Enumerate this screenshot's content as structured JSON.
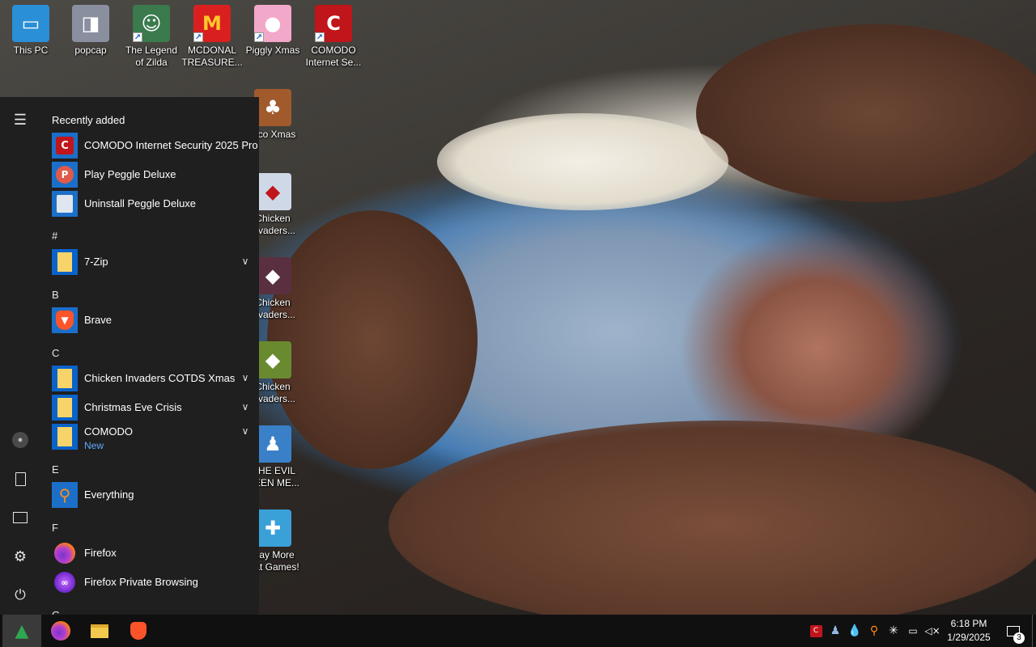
{
  "desktop": {
    "icons": [
      {
        "label": "This PC",
        "icon": "computer-icon",
        "color": "#2a8fd6"
      },
      {
        "label": "popcap",
        "icon": "folder-icon",
        "color": "#8a8fa0"
      },
      {
        "label": "The Legend of Zilda",
        "icon": "zilda-game-icon",
        "color": "#3a7a4c"
      },
      {
        "label": "MCDONAL TREASURE...",
        "icon": "mcdonalds-icon",
        "color": "#da1f1f"
      },
      {
        "label": "Piggly Xmas",
        "icon": "pig-icon",
        "color": "#f2a8c8"
      },
      {
        "label": "COMODO Internet Se...",
        "icon": "comodo-icon",
        "color": "#c0151a"
      },
      {
        "label": "...co Xmas",
        "icon": "bear-icon",
        "color": "#a05a2c"
      },
      {
        "label": "Chicken ...vaders...",
        "icon": "chicken-icon",
        "color": "#cfd8e6"
      },
      {
        "label": "Chicken ...vaders...",
        "icon": "chicken-icon",
        "color": "#5a3040"
      },
      {
        "label": "Chicken ...vaders...",
        "icon": "chicken-icon",
        "color": "#6a8a30"
      },
      {
        "label": "...HE EVIL ...EEN ME...",
        "icon": "people-icon",
        "color": "#3a80c8"
      },
      {
        "label": "...ay More ...at Games!",
        "icon": "games-icon",
        "color": "#3aa0d8"
      }
    ]
  },
  "start_menu": {
    "section_title": "Recently added",
    "recent": [
      {
        "name": "COMODO Internet Security 2025 Pro",
        "icon": "comodo-icon",
        "color": "#c0151a"
      },
      {
        "name": "Play Peggle Deluxe",
        "icon": "peggle-icon",
        "color": "#3b78c4"
      },
      {
        "name": "Uninstall Peggle Deluxe",
        "icon": "uninstall-icon",
        "color": "#3b78c4"
      }
    ],
    "groups": [
      {
        "letter": "#",
        "apps": [
          {
            "name": "7-Zip",
            "icon": "folder-icon",
            "expandable": true
          }
        ]
      },
      {
        "letter": "B",
        "apps": [
          {
            "name": "Brave",
            "icon": "brave-icon"
          }
        ]
      },
      {
        "letter": "C",
        "apps": [
          {
            "name": "Chicken Invaders COTDS Xmas",
            "icon": "folder-icon",
            "expandable": true
          },
          {
            "name": "Christmas Eve Crisis",
            "icon": "folder-icon",
            "expandable": true
          },
          {
            "name": "COMODO",
            "subtitle": "New",
            "icon": "folder-icon",
            "expandable": true
          }
        ]
      },
      {
        "letter": "E",
        "apps": [
          {
            "name": "Everything",
            "icon": "search-icon"
          }
        ]
      },
      {
        "letter": "F",
        "apps": [
          {
            "name": "Firefox",
            "icon": "firefox-icon"
          },
          {
            "name": "Firefox Private Browsing",
            "icon": "private-browsing-icon"
          }
        ]
      },
      {
        "letter": "G",
        "apps": []
      }
    ],
    "rail": [
      "hamburger-icon",
      "user-icon",
      "documents-icon",
      "pictures-icon",
      "settings-icon",
      "power-icon"
    ]
  },
  "taskbar": {
    "pinned": [
      "firefox-icon",
      "file-explorer-icon",
      "brave-icon"
    ],
    "tray": [
      "comodo-icon",
      "network-user-icon",
      "droplet-icon",
      "search-icon",
      "sun-icon",
      "network-icon",
      "volume-muted-icon"
    ],
    "time": "6:18 PM",
    "date": "1/29/2025",
    "notification_count": "3"
  },
  "colors": {
    "start_bg": "#1f1f1f",
    "taskbar_bg": "#101010",
    "tile_blue": "#0a63c9",
    "folder_yellow": "#f7d46a",
    "accent_new": "#5fa8ff"
  }
}
